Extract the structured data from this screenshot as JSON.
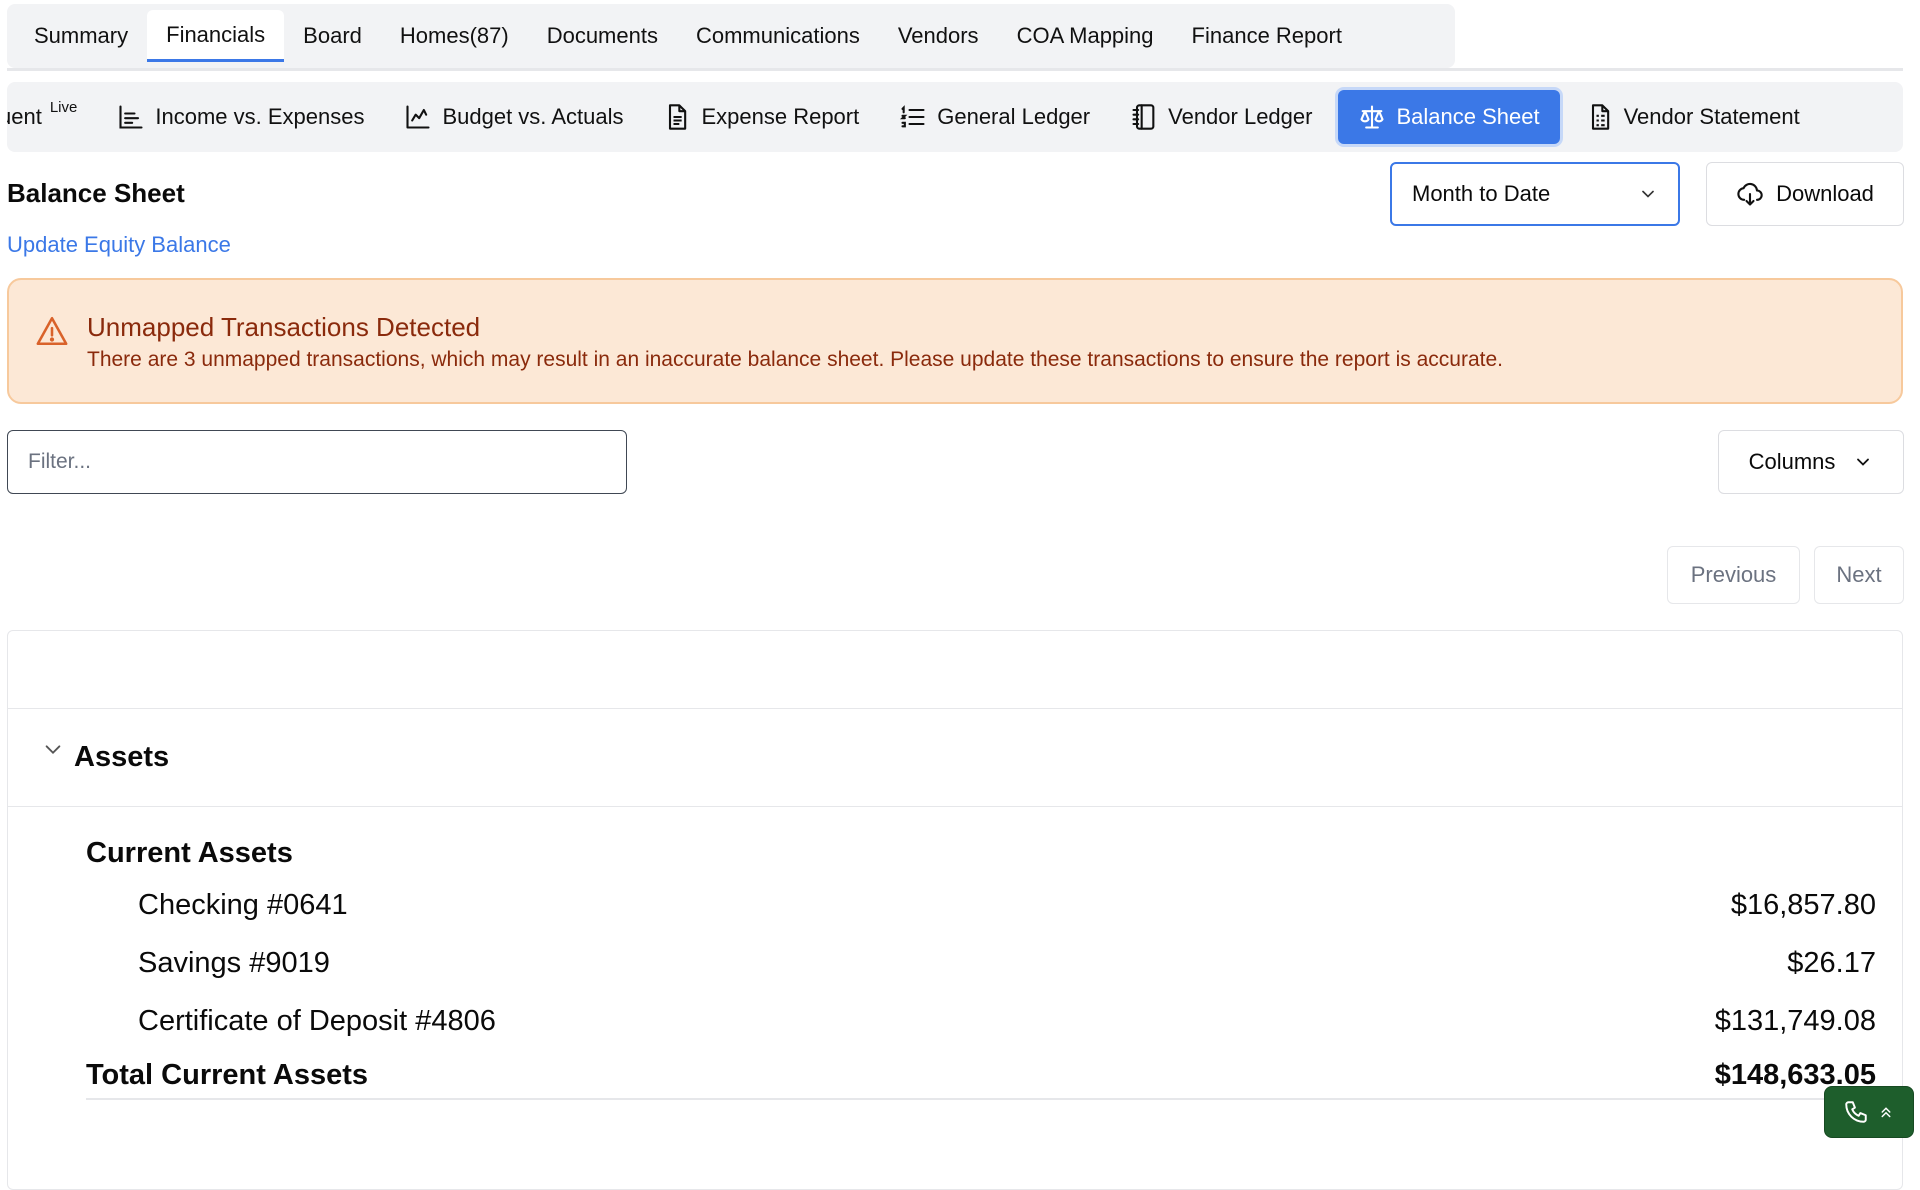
{
  "top_tabs": [
    {
      "label": "Summary"
    },
    {
      "label": "Financials"
    },
    {
      "label": "Board"
    },
    {
      "label": "Homes(87)"
    },
    {
      "label": "Documents"
    },
    {
      "label": "Communications"
    },
    {
      "label": "Vendors"
    },
    {
      "label": "COA Mapping"
    },
    {
      "label": "Finance Report"
    }
  ],
  "active_top_tab": "Financials",
  "sub_tabs": {
    "partial_label": "uent",
    "live_badge": "Live",
    "items": [
      {
        "label": "Income vs. Expenses",
        "icon": "axis-chart-icon"
      },
      {
        "label": "Budget vs. Actuals",
        "icon": "line-chart-icon"
      },
      {
        "label": "Expense Report",
        "icon": "document-icon"
      },
      {
        "label": "General Ledger",
        "icon": "list-icon"
      },
      {
        "label": "Vendor Ledger",
        "icon": "notebook-icon"
      },
      {
        "label": "Balance Sheet",
        "icon": "scale-icon"
      },
      {
        "label": "Vendor Statement",
        "icon": "statement-icon"
      }
    ],
    "active": "Balance Sheet"
  },
  "header": {
    "title": "Balance Sheet",
    "update_link": "Update Equity Balance",
    "period_selected": "Month to Date",
    "download_label": "Download"
  },
  "alert": {
    "title": "Unmapped Transactions Detected",
    "message": "There are 3 unmapped transactions, which may result in an inaccurate balance sheet. Please update these transactions to ensure the report is accurate.",
    "icon": "warning-icon"
  },
  "filter": {
    "placeholder": "Filter...",
    "value": ""
  },
  "columns_label": "Columns",
  "pagination": {
    "previous": "Previous",
    "next": "Next"
  },
  "table": {
    "section": "Assets",
    "group": "Current Assets",
    "accounts": [
      {
        "name": "Checking #0641",
        "amount": "$16,857.80"
      },
      {
        "name": "Savings #9019",
        "amount": "$26.17"
      },
      {
        "name": "Certificate of Deposit #4806",
        "amount": "$131,749.08"
      }
    ],
    "total_label": "Total Current Assets",
    "total_amount": "$148,633.05"
  },
  "colors": {
    "accent": "#3b78e7",
    "alert_bg": "#fce8d6",
    "alert_text": "#8a2a0c",
    "call_widget": "#1e5e2c"
  }
}
